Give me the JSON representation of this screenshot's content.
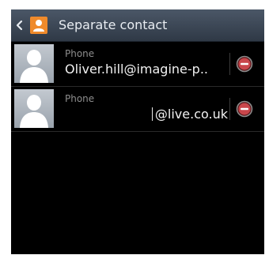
{
  "action_bar": {
    "title": "Separate contact",
    "back_icon": "chevron-left-icon",
    "app_icon": "contact-person-icon",
    "app_icon_color": "#ef8a2b"
  },
  "contacts": [
    {
      "label": "Phone",
      "value": "Oliver.hill@imagine-p..",
      "avatar_icon": "default-avatar-icon",
      "action_icon": "remove-circle-icon"
    },
    {
      "label": "Phone",
      "value": "@live.co.uk",
      "avatar_icon": "default-avatar-icon",
      "action_icon": "remove-circle-icon"
    }
  ],
  "colors": {
    "background": "#000000",
    "action_bar": "#3b4654",
    "label": "#8e8e8e",
    "value": "#f2f2f2",
    "remove_icon": "#c9464b"
  }
}
